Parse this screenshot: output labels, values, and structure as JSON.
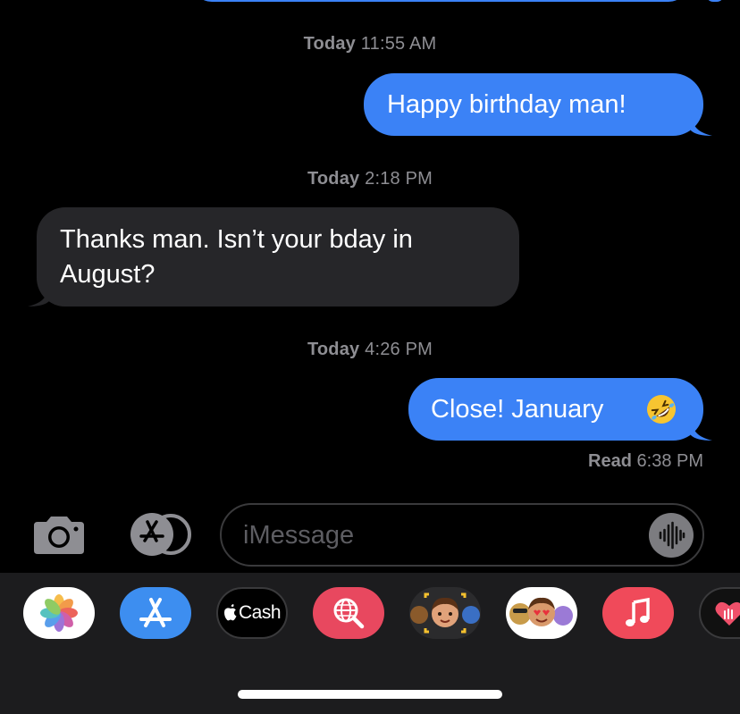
{
  "conversation": {
    "timestamps": [
      {
        "day": "Today",
        "time": "11:55 AM"
      },
      {
        "day": "Today",
        "time": "2:18 PM"
      },
      {
        "day": "Today",
        "time": "4:26 PM"
      }
    ],
    "messages": [
      {
        "direction": "sent",
        "text": "Happy birthday man!"
      },
      {
        "direction": "received",
        "line1": "Thanks man. Isn’t your bday in",
        "line2": "August?"
      },
      {
        "direction": "sent",
        "text": "Close! January",
        "emoji": "rolling-on-the-floor-laughing-emoji"
      }
    ],
    "read_receipt": {
      "label": "Read",
      "time": "6:38 PM"
    }
  },
  "input_bar": {
    "placeholder": "iMessage",
    "icons": [
      "camera-icon",
      "app-store-icon",
      "audio-waveform-icon"
    ]
  },
  "app_drawer": {
    "apps": [
      {
        "name": "Photos",
        "icon": "photos-icon"
      },
      {
        "name": "App Store",
        "icon": "app-store-icon"
      },
      {
        "name": "Apple Cash",
        "icon": "apple-logo-icon",
        "label": "Cash"
      },
      {
        "name": "Search Images",
        "icon": "globe-search-icon"
      },
      {
        "name": "Memoji",
        "icon": "memoji-icon"
      },
      {
        "name": "Memoji Stickers",
        "icon": "memoji-stickers-icon"
      },
      {
        "name": "Music",
        "icon": "music-note-icon"
      },
      {
        "name": "Digital Touch",
        "icon": "heart-touch-icon"
      }
    ]
  },
  "colors": {
    "sent_bubble": "#3b82f6",
    "received_bubble": "#262629",
    "background": "#000000",
    "timestamp_text": "#8e8e93",
    "drawer_background": "#1c1c1e"
  }
}
